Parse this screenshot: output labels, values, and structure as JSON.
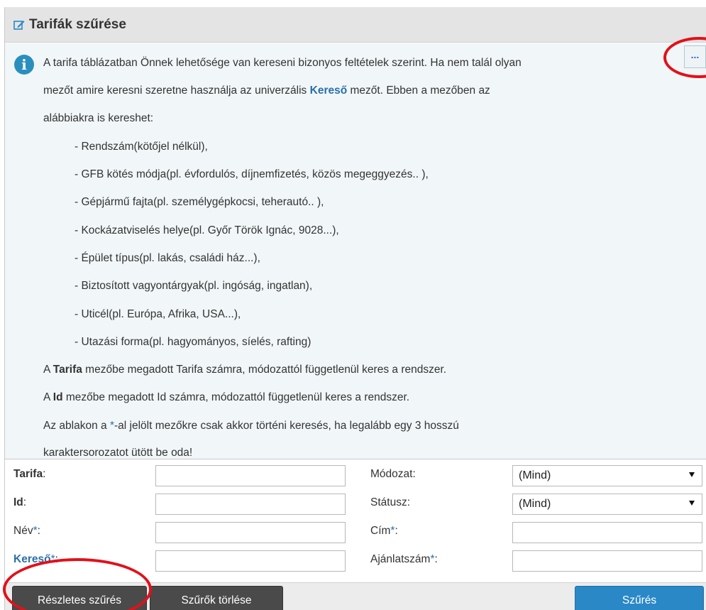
{
  "header": {
    "title": "Tarifák szűrése",
    "icon": "edit-icon"
  },
  "info": {
    "icon": "info-icon",
    "icon_glyph": "i",
    "more_button": "...",
    "line1": "A tarifa táblázatban Önnek lehetősége van kereseni bizonyos feltételek szerint. Ha nem talál olyan",
    "line2_pre": "mezőt amire keresni szeretne használja az univerzális ",
    "line2_kw": "Kereső",
    "line2_post": " mezőt. Ebben a mezőben az",
    "line3": "alábbiakra is kereshet:",
    "items": [
      "- Rendszám(kötőjel nélkül),",
      "- GFB kötés módja(pl. évfordulós, díjnemfizetés, közös megeggyezés.. ),",
      "- Gépjármű fajta(pl. személygépkocsi, teherautó.. ),",
      "- Kockázatviselés helye(pl. Győr Török Ignác, 9028...),",
      "- Épület típus(pl. lakás, családi ház...),",
      "- Biztosított vagyontárgyak(pl. ingóság, ingatlan),",
      "- Uticél(pl. Európa, Afrika, USA...),",
      "- Utazási forma(pl. hagyományos, síelés, rafting)"
    ],
    "tarifa_pre": "A ",
    "tarifa_kw": "Tarifa",
    "tarifa_post": " mezőbe megadott Tarifa számra, módozattól függetlenül keres a rendszer.",
    "id_pre": "A ",
    "id_kw": "Id",
    "id_post": " mezőbe megadott Id számra, módozattól függetlenül keres a rendszer.",
    "star_pre": "Az ablakon a ",
    "star": "*",
    "star_post": "-al jelölt mezőkre csak akkor történi keresés, ha legalább egy 3 hosszú",
    "last": "karaktersorozatot ütött be oda!"
  },
  "form": {
    "tarifa_label": "Tarifa",
    "id_label": "Id",
    "nev_label": "Név",
    "kereso_label": "Kereső",
    "modozat_label": "Módozat",
    "statusz_label": "Státusz",
    "cim_label": "Cím",
    "ajanlat_label": "Ajánlatszám",
    "colon": ":",
    "star": "*",
    "modozat_value": "(Mind)",
    "statusz_value": "(Mind)",
    "tarifa_value": "",
    "id_value": "",
    "nev_value": "",
    "kereso_value": "",
    "cim_value": "",
    "ajanlat_value": ""
  },
  "buttons": {
    "reszletes": "Részletes szűrés",
    "torles": "Szűrők törlése",
    "szures": "Szűrés"
  },
  "colors": {
    "accent": "#2a88c6",
    "link": "#2a6fa8",
    "annotation": "#e2101a"
  }
}
